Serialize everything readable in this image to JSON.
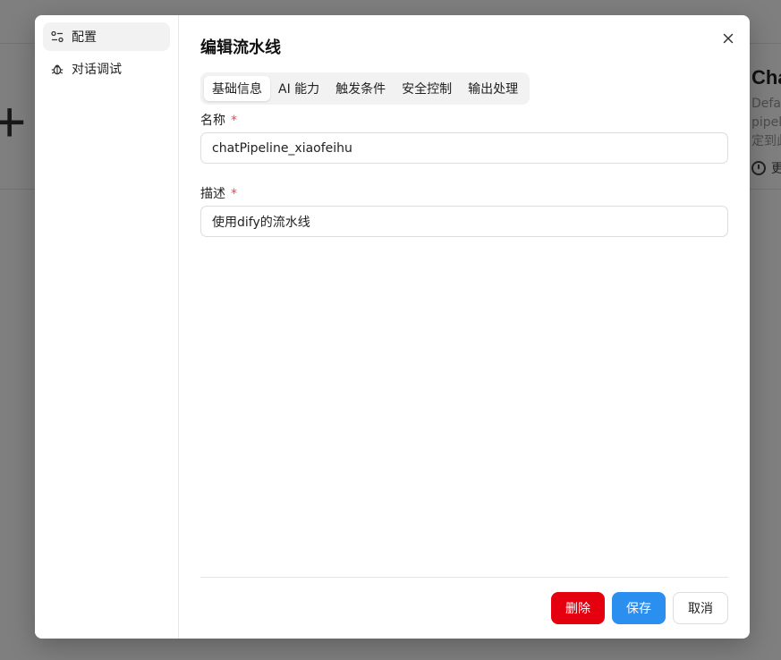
{
  "background": {
    "card_title": "Cha",
    "card_desc_lines": [
      "Defau",
      "pipel",
      "定到此"
    ],
    "card_meta": "更",
    "plus_glyph": "+"
  },
  "dialog": {
    "title": "编辑流水线",
    "nav": [
      {
        "label": "配置",
        "icon": "settings-sliders-icon",
        "active": true
      },
      {
        "label": "对话调试",
        "icon": "bug-icon",
        "active": false
      }
    ],
    "tabs": [
      {
        "label": "基础信息",
        "active": true
      },
      {
        "label": "AI 能力",
        "active": false
      },
      {
        "label": "触发条件",
        "active": false
      },
      {
        "label": "安全控制",
        "active": false
      },
      {
        "label": "输出处理",
        "active": false
      }
    ],
    "fields": {
      "name": {
        "label": "名称",
        "required_mark": "*",
        "value": "chatPipeline_xiaofeihu"
      },
      "description": {
        "label": "描述",
        "required_mark": "*",
        "value": "使用dify的流水线"
      }
    },
    "buttons": {
      "delete": "删除",
      "save": "保存",
      "cancel": "取消"
    },
    "colors": {
      "delete": "#e5000f",
      "save": "#2b8ff0",
      "required": "#e5484d"
    }
  }
}
